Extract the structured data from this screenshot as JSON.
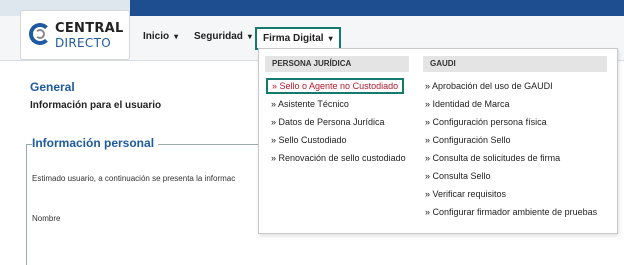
{
  "logo": {
    "line1": "CENTRAL",
    "line2": "DIRECTO"
  },
  "nav": {
    "items": [
      {
        "label": "Inicio",
        "caret": "▾"
      },
      {
        "label": "Seguridad",
        "caret": "▾"
      },
      {
        "label": "Firma Digital",
        "caret": "▾"
      }
    ]
  },
  "page": {
    "title": "General",
    "subtitle": "Información para el usuario",
    "section_legend": "Información personal",
    "paragraph": "Estimado usuario, a continuación se presenta la informac",
    "field_label": "Nombre"
  },
  "dropdown": {
    "col1_header": "PERSONA JURÍDICA",
    "col2_header": "GAUDI",
    "col1_items": [
      "» Sello o Agente no Custodiado",
      "» Asistente Técnico",
      "» Datos de Persona Jurídica",
      "» Sello Custodiado",
      "» Renovación de sello custodiado"
    ],
    "col2_items": [
      "» Aprobación del uso de GAUDI",
      "» Identidad de Marca",
      "» Configuración persona física",
      "» Configuración Sello",
      "» Consulta de solicitudes de firma",
      "» Consulta Sello",
      "» Verificar requisitos",
      "» Configurar firmador ambiente de pruebas"
    ]
  },
  "colors": {
    "brand_blue": "#1e5aa0",
    "header_blue": "#1e4e8f",
    "highlight_border": "#157a6e",
    "active_text": "#b5172b"
  }
}
